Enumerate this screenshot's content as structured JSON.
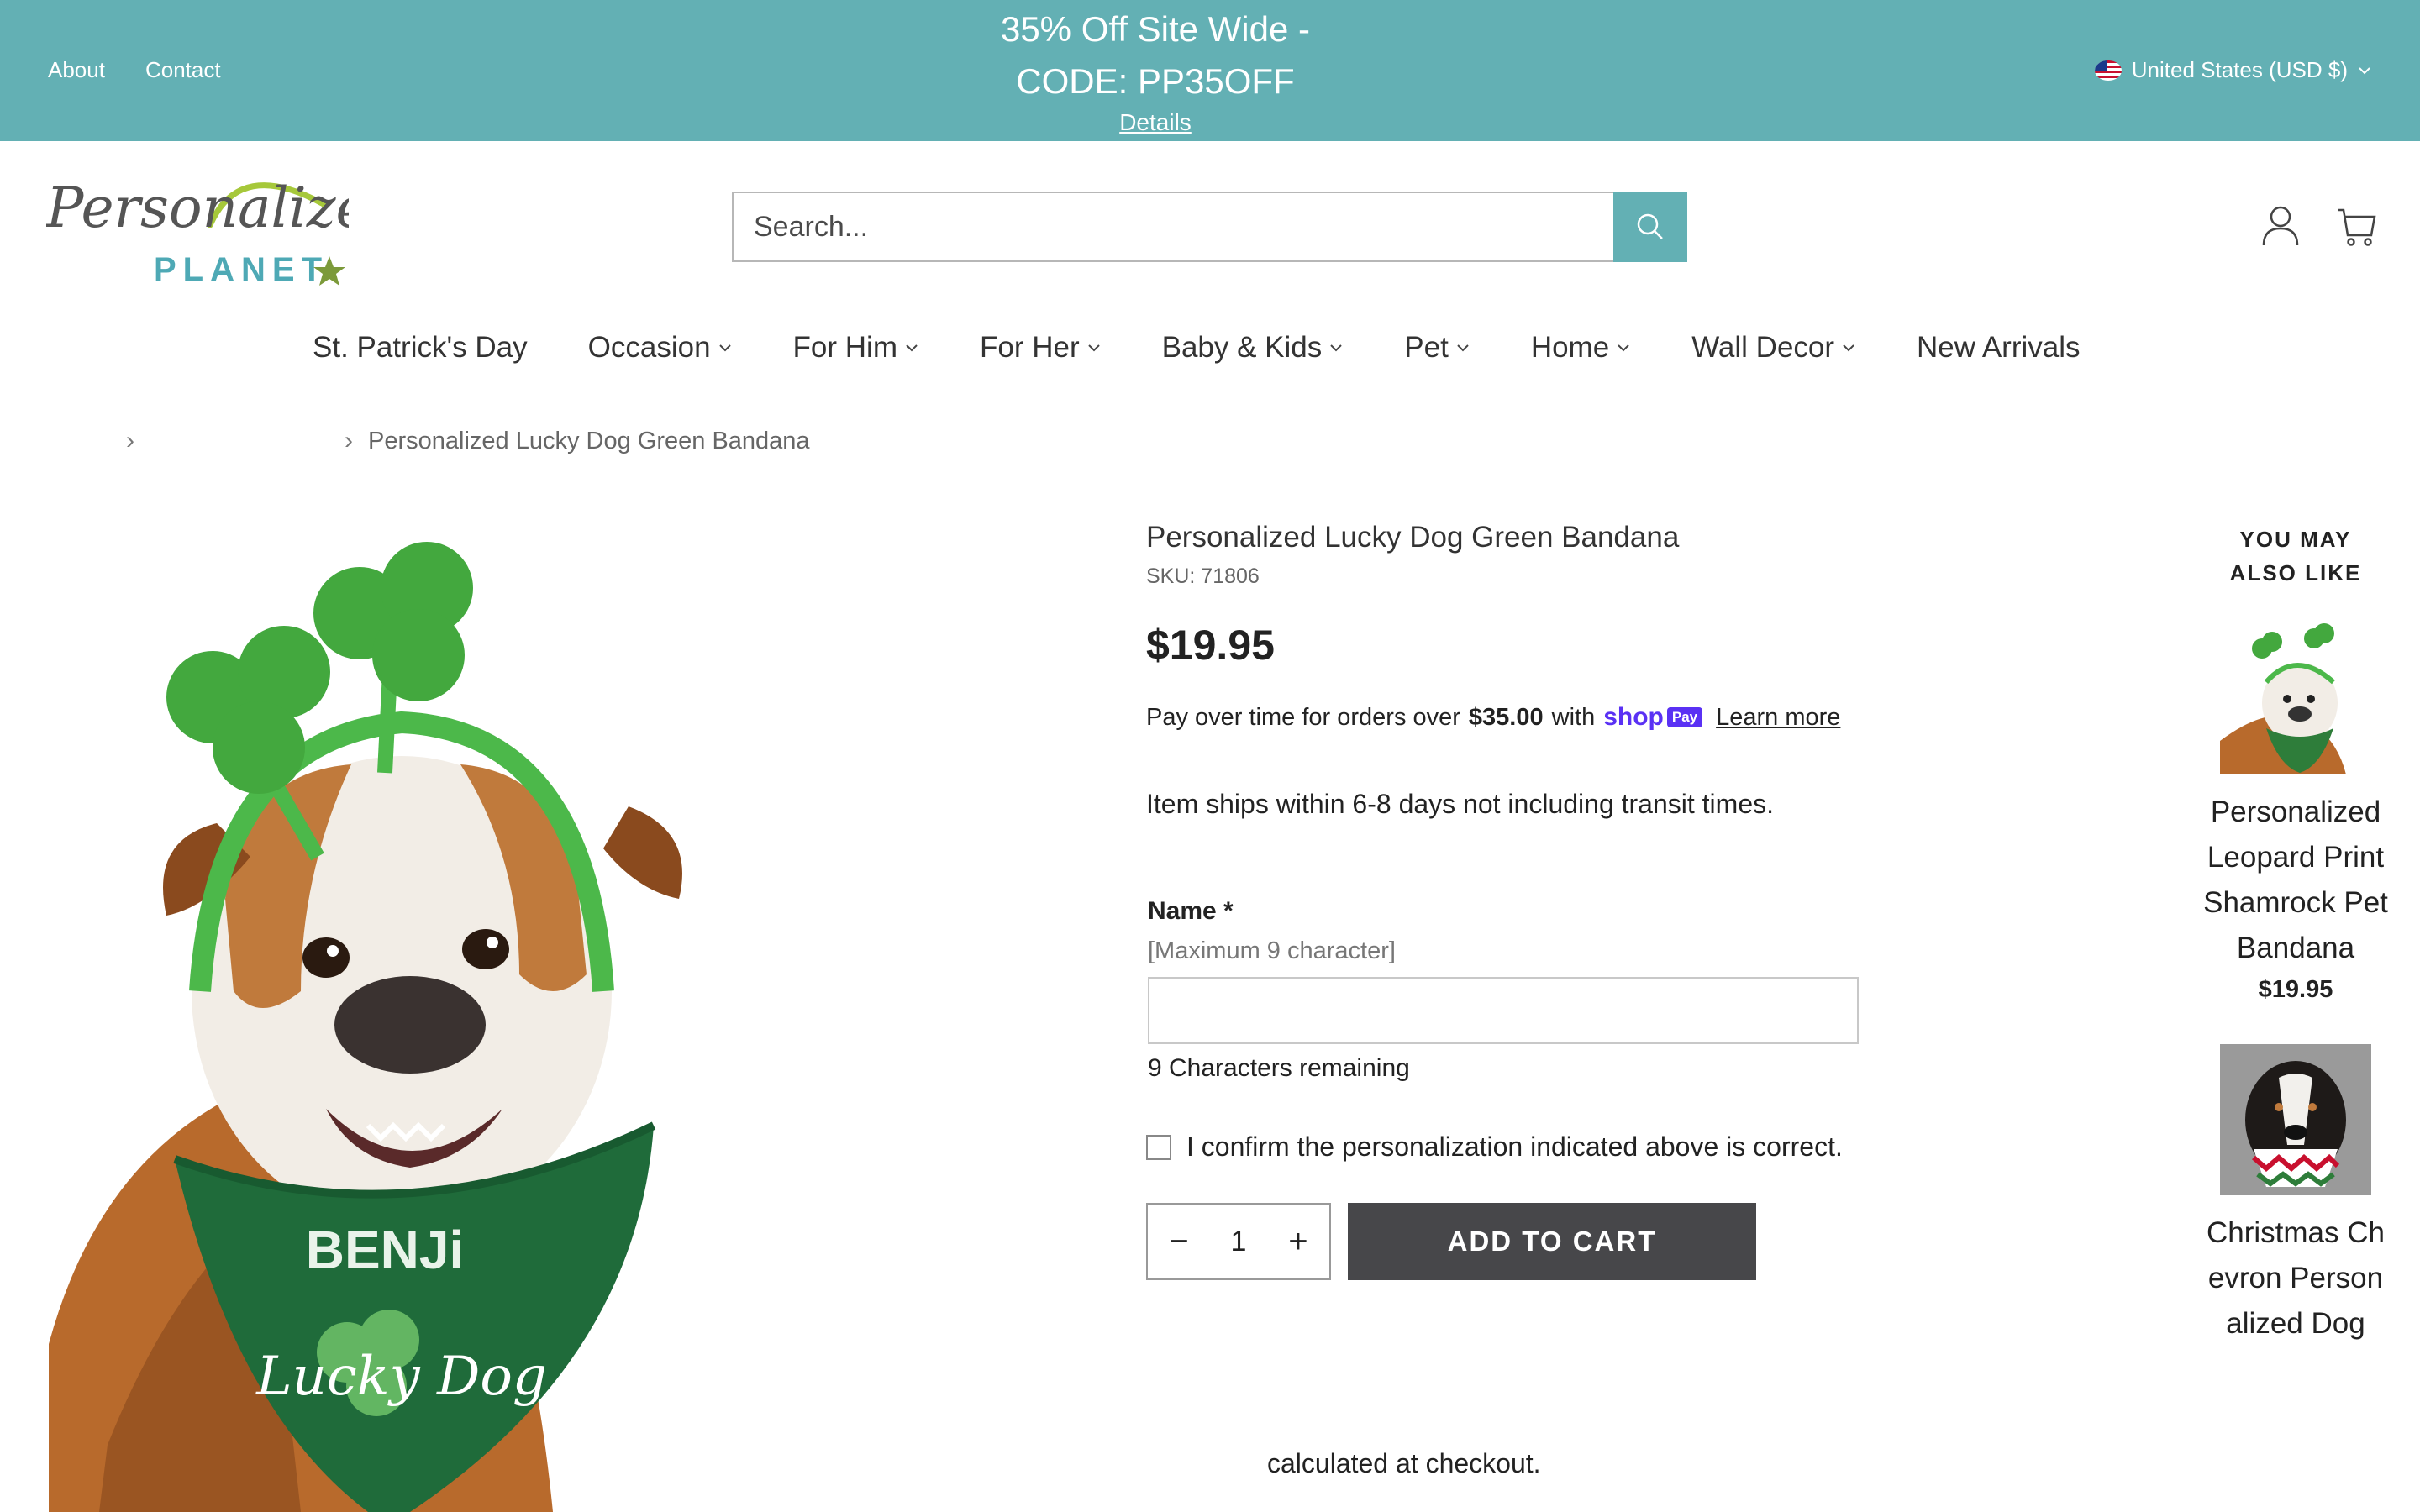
{
  "topbar": {
    "links": [
      "About",
      "Contact"
    ],
    "promo_line1": "35% Off Site Wide -",
    "promo_line2": "CODE: PP35OFF",
    "details": "Details",
    "currency": "United States (USD $)"
  },
  "header": {
    "logo_text": "Personalized",
    "logo_sub": "PLANET",
    "search_placeholder": "Search..."
  },
  "nav": [
    {
      "label": "St. Patrick's Day",
      "dropdown": false
    },
    {
      "label": "Occasion",
      "dropdown": true
    },
    {
      "label": "For Him",
      "dropdown": true
    },
    {
      "label": "For Her",
      "dropdown": true
    },
    {
      "label": "Baby & Kids",
      "dropdown": true
    },
    {
      "label": "Pet",
      "dropdown": true
    },
    {
      "label": "Home",
      "dropdown": true
    },
    {
      "label": "Wall Decor",
      "dropdown": true
    },
    {
      "label": "New Arrivals",
      "dropdown": false
    }
  ],
  "breadcrumb": {
    "current": "Personalized Lucky Dog Green Bandana"
  },
  "product": {
    "title": "Personalized Lucky Dog Green Bandana",
    "sku": "SKU: 71806",
    "price": "$19.95",
    "paylater_pre": "Pay over time for orders over",
    "paylater_amount": "$35.00",
    "paylater_with": "with",
    "shop_word": "shop",
    "pay_word": "Pay",
    "learn_more": "Learn more",
    "ships": "Item ships within 6-8 days not including transit times.",
    "name_label": "Name *",
    "name_hint": "[Maximum 9 character]",
    "name_value": "",
    "remaining": "9 Characters remaining",
    "confirm": "I confirm the personalization indicated above is correct.",
    "qty": "1",
    "add_to_cart": "ADD TO CART",
    "calc": "calculated at checkout.",
    "image_text_name": "BENJi",
    "image_text_tag": "Lucky Dog"
  },
  "also_like": {
    "heading_line1": "YOU MAY",
    "heading_line2": "ALSO LIKE",
    "items": [
      {
        "name": "Personalized Leopard Print Shamrock Pet Bandana",
        "price": "$19.95"
      },
      {
        "name": "Christmas Chevron Personalized Dog",
        "price": ""
      }
    ]
  },
  "colors": {
    "topbar": "#63b0b4",
    "button_dark": "#47474a",
    "shoppay": "#5a31f4",
    "bandana_green": "#1f6b3a",
    "shamrock_green": "#3fae3a"
  }
}
